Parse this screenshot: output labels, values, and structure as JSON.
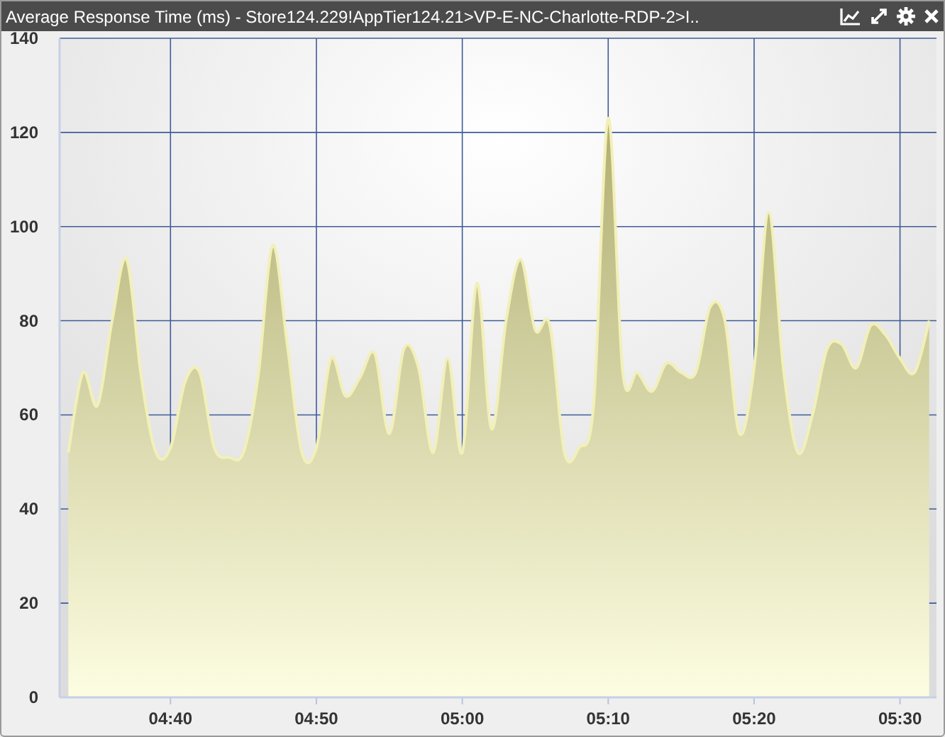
{
  "window": {
    "title": "Average Response Time (ms) - Store124.229!AppTier124.21>VP-E-NC-Charlotte-RDP-2>I.."
  },
  "chart": {
    "chart_data": {
      "type": "area",
      "categories": [
        null,
        null,
        null,
        null,
        null,
        null,
        null,
        "04:40",
        null,
        null,
        null,
        null,
        null,
        null,
        null,
        null,
        null,
        "04:50",
        null,
        null,
        null,
        null,
        null,
        null,
        null,
        null,
        null,
        "05:00",
        null,
        null,
        null,
        null,
        null,
        null,
        null,
        null,
        null,
        "05:10",
        null,
        null,
        null,
        null,
        null,
        null,
        null,
        null,
        null,
        "05:20",
        null,
        null,
        null,
        null,
        null,
        null,
        null,
        null,
        null,
        "05:30",
        null,
        null
      ],
      "series": [
        {
          "color": "#b0ae70",
          "values": [
            52,
            69,
            62,
            80,
            93,
            68,
            52,
            53,
            67,
            69,
            53,
            51,
            52,
            68,
            96,
            75,
            52,
            53,
            72,
            64,
            68,
            73,
            56,
            74,
            70,
            52,
            72,
            52,
            88,
            57,
            80,
            93,
            78,
            79,
            52,
            53,
            62,
            123,
            69,
            69,
            65,
            71,
            69,
            69,
            83,
            80,
            56,
            70,
            103,
            70,
            52,
            60,
            74,
            75,
            70,
            79,
            77,
            72,
            69,
            80
          ]
        }
      ],
      "ylim": [
        0,
        140
      ],
      "grid": true,
      "yticks": [
        0,
        20,
        40,
        60,
        80,
        100,
        120,
        140
      ]
    }
  }
}
